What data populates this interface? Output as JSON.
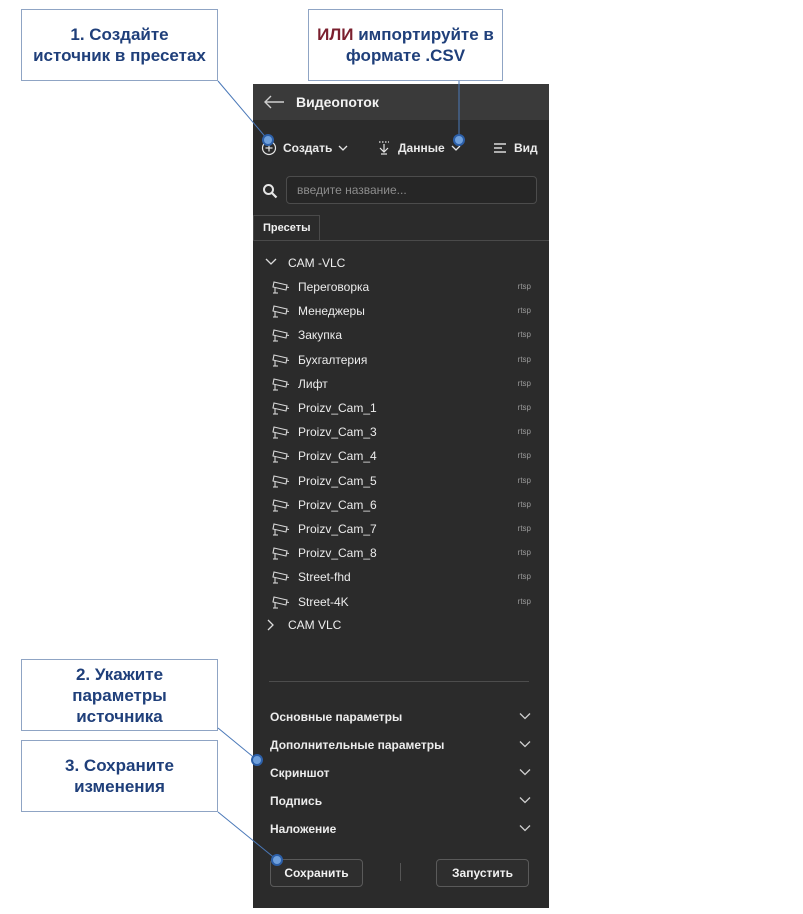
{
  "callouts": {
    "step1": "1. Создайте источник в пресетах",
    "or_word": "ИЛИ",
    "import": "импортируйте в формате .CSV",
    "step2": "2. Укажите параметры источника",
    "step3": "3. Сохраните изменения"
  },
  "panel": {
    "title": "Видеопоток",
    "toolbar": {
      "create": "Создать",
      "data": "Данные",
      "view": "Вид"
    },
    "search": {
      "placeholder": "введите название..."
    },
    "tabs": [
      "Пресеты"
    ],
    "groups": [
      {
        "label": "CAM -VLC",
        "expanded": true
      },
      {
        "label": "CAM VLC",
        "expanded": false
      }
    ],
    "items": [
      {
        "label": "Переговорка",
        "protocol": "rtsp"
      },
      {
        "label": "Менеджеры",
        "protocol": "rtsp"
      },
      {
        "label": "Закупка",
        "protocol": "rtsp"
      },
      {
        "label": "Бухгалтерия",
        "protocol": "rtsp"
      },
      {
        "label": "Лифт",
        "protocol": "rtsp"
      },
      {
        "label": "Proizv_Cam_1",
        "protocol": "rtsp"
      },
      {
        "label": "Proizv_Cam_3",
        "protocol": "rtsp"
      },
      {
        "label": "Proizv_Cam_4",
        "protocol": "rtsp"
      },
      {
        "label": "Proizv_Cam_5",
        "protocol": "rtsp"
      },
      {
        "label": "Proizv_Cam_6",
        "protocol": "rtsp"
      },
      {
        "label": "Proizv_Cam_7",
        "protocol": "rtsp"
      },
      {
        "label": "Proizv_Cam_8",
        "protocol": "rtsp"
      },
      {
        "label": "Street-fhd",
        "protocol": "rtsp"
      },
      {
        "label": "Street-4K",
        "protocol": "rtsp"
      }
    ],
    "sections": [
      "Основные параметры",
      "Дополнительные параметры",
      "Скриншот",
      "Подпись",
      "Наложение"
    ],
    "buttons": {
      "save": "Сохранить",
      "run": "Запустить"
    }
  },
  "colors": {
    "panel_bg": "#2b2b2b",
    "titlebar_bg": "#3a3a3a",
    "callout_text": "#1f3f7a",
    "callout_accent": "#7a1f2e",
    "connector": "#4a78b8"
  }
}
